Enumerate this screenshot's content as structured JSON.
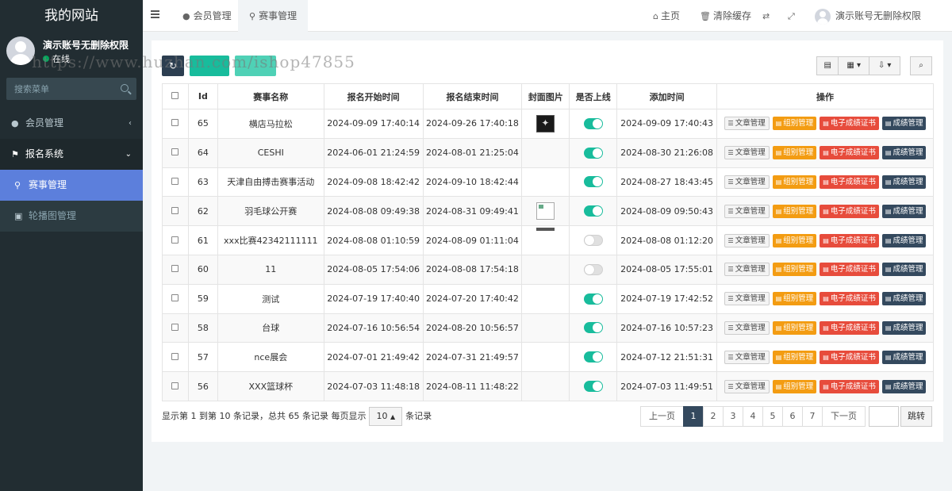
{
  "sidebar": {
    "logo": "我的网站",
    "user_name": "演示账号无删除权限",
    "user_status": "在线",
    "search_placeholder": "搜索菜单",
    "items": [
      {
        "label": "会员管理",
        "icon": "user-circle-icon"
      },
      {
        "label": "报名系统",
        "icon": "flag-icon"
      },
      {
        "label": "赛事管理",
        "icon": "map-marker-icon"
      },
      {
        "label": "轮播图管理",
        "icon": "image-icon"
      }
    ]
  },
  "topbar": {
    "tabs": [
      {
        "label": "会员管理",
        "icon": "user-icon"
      },
      {
        "label": "赛事管理",
        "icon": "map-marker-icon"
      }
    ],
    "home": "主页",
    "clear_cache": "清除缓存",
    "user_name": "演示账号无删除权限"
  },
  "watermark": "https://www.huzhan.com/ishop47855",
  "table": {
    "headers": [
      "Id",
      "赛事名称",
      "报名开始时间",
      "报名结束时间",
      "封面图片",
      "是否上线",
      "添加时间",
      "操作"
    ],
    "ops": [
      "文章管理",
      "组别管理",
      "电子成绩证书",
      "成绩管理"
    ],
    "rows": [
      {
        "id": "65",
        "name": "横店马拉松",
        "start": "2024-09-09 17:40:14",
        "end": "2024-09-26 17:40:18",
        "cover": "dark",
        "online": true,
        "added": "2024-09-09 17:40:43"
      },
      {
        "id": "64",
        "name": "CESHI",
        "start": "2024-06-01 21:24:59",
        "end": "2024-08-01 21:25:04",
        "cover": "none",
        "online": true,
        "added": "2024-08-30 21:26:08"
      },
      {
        "id": "63",
        "name": "天津自由搏击赛事活动",
        "start": "2024-09-08 18:42:42",
        "end": "2024-09-10 18:42:44",
        "cover": "none",
        "online": true,
        "added": "2024-08-27 18:43:45"
      },
      {
        "id": "62",
        "name": "羽毛球公开赛",
        "start": "2024-08-08 09:49:38",
        "end": "2024-08-31 09:49:41",
        "cover": "broken",
        "online": true,
        "added": "2024-08-09 09:50:43"
      },
      {
        "id": "61",
        "name": "xxx比赛42342111111",
        "start": "2024-08-08 01:10:59",
        "end": "2024-08-09 01:11:04",
        "cover": "thin",
        "online": false,
        "added": "2024-08-08 01:12:20"
      },
      {
        "id": "60",
        "name": "11",
        "start": "2024-08-05 17:54:06",
        "end": "2024-08-08 17:54:18",
        "cover": "none",
        "online": false,
        "added": "2024-08-05 17:55:01"
      },
      {
        "id": "59",
        "name": "测试",
        "start": "2024-07-19 17:40:40",
        "end": "2024-07-20 17:40:42",
        "cover": "none",
        "online": true,
        "added": "2024-07-19 17:42:52"
      },
      {
        "id": "58",
        "name": "台球",
        "start": "2024-07-16 10:56:54",
        "end": "2024-08-20 10:56:57",
        "cover": "none",
        "online": true,
        "added": "2024-07-16 10:57:23"
      },
      {
        "id": "57",
        "name": "nce展会",
        "start": "2024-07-01 21:49:42",
        "end": "2024-07-31 21:49:57",
        "cover": "none",
        "online": true,
        "added": "2024-07-12 21:51:31"
      },
      {
        "id": "56",
        "name": "XXX篮球杯",
        "start": "2024-07-03 11:48:18",
        "end": "2024-08-11 11:48:22",
        "cover": "none",
        "online": true,
        "added": "2024-07-03 11:49:51"
      }
    ]
  },
  "footer": {
    "info_before": "显示第 1 到第 10 条记录，总共 65 条记录 每页显示",
    "page_size": "10",
    "info_after": "条记录",
    "prev": "上一页",
    "pages": [
      "1",
      "2",
      "3",
      "4",
      "5",
      "6",
      "7"
    ],
    "current_page": "1",
    "next": "下一页",
    "jump": "跳转"
  }
}
